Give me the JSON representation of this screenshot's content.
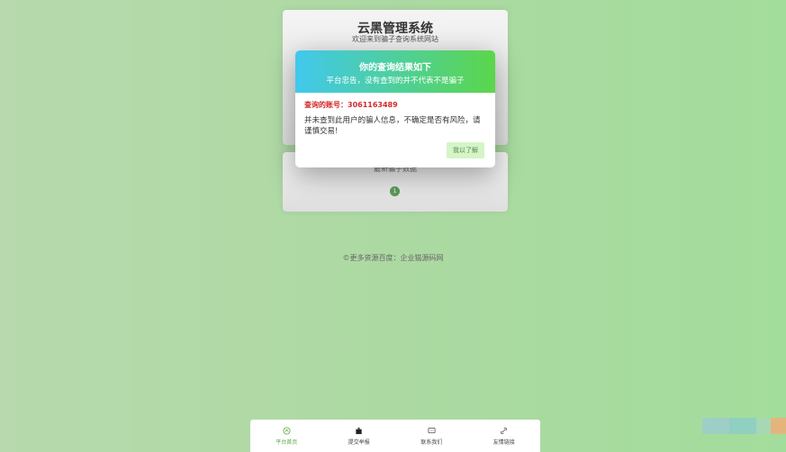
{
  "header": {
    "title": "云黑管理系统",
    "subtitle": "欢迎来到骗子查询系统网站"
  },
  "latest": {
    "label": "最新骗子数据",
    "page": "1"
  },
  "footer": {
    "text": "©更多资源百度：企业猫源码网"
  },
  "modal": {
    "title": "你的查询结果如下",
    "notice": "平台忠告，没有查到的并不代表不是骗子",
    "account_label": "查询的账号：",
    "account_value": "3061163489",
    "message": "并未查到此用户的骗人信息，不确定是否有风险，请谨慎交易!",
    "ok_label": "我以了解"
  },
  "nav": {
    "items": [
      {
        "label": "平台首页",
        "icon": "home-icon",
        "active": true
      },
      {
        "label": "提交举报",
        "icon": "report-icon",
        "active": false
      },
      {
        "label": "联系我们",
        "icon": "chat-icon",
        "active": false
      },
      {
        "label": "友情链接",
        "icon": "link-icon",
        "active": false
      }
    ]
  },
  "colors": {
    "accent": "#5aa845",
    "danger": "#d42a2a",
    "modal_gradient_start": "#41c8ed",
    "modal_gradient_end": "#5bd64b"
  }
}
